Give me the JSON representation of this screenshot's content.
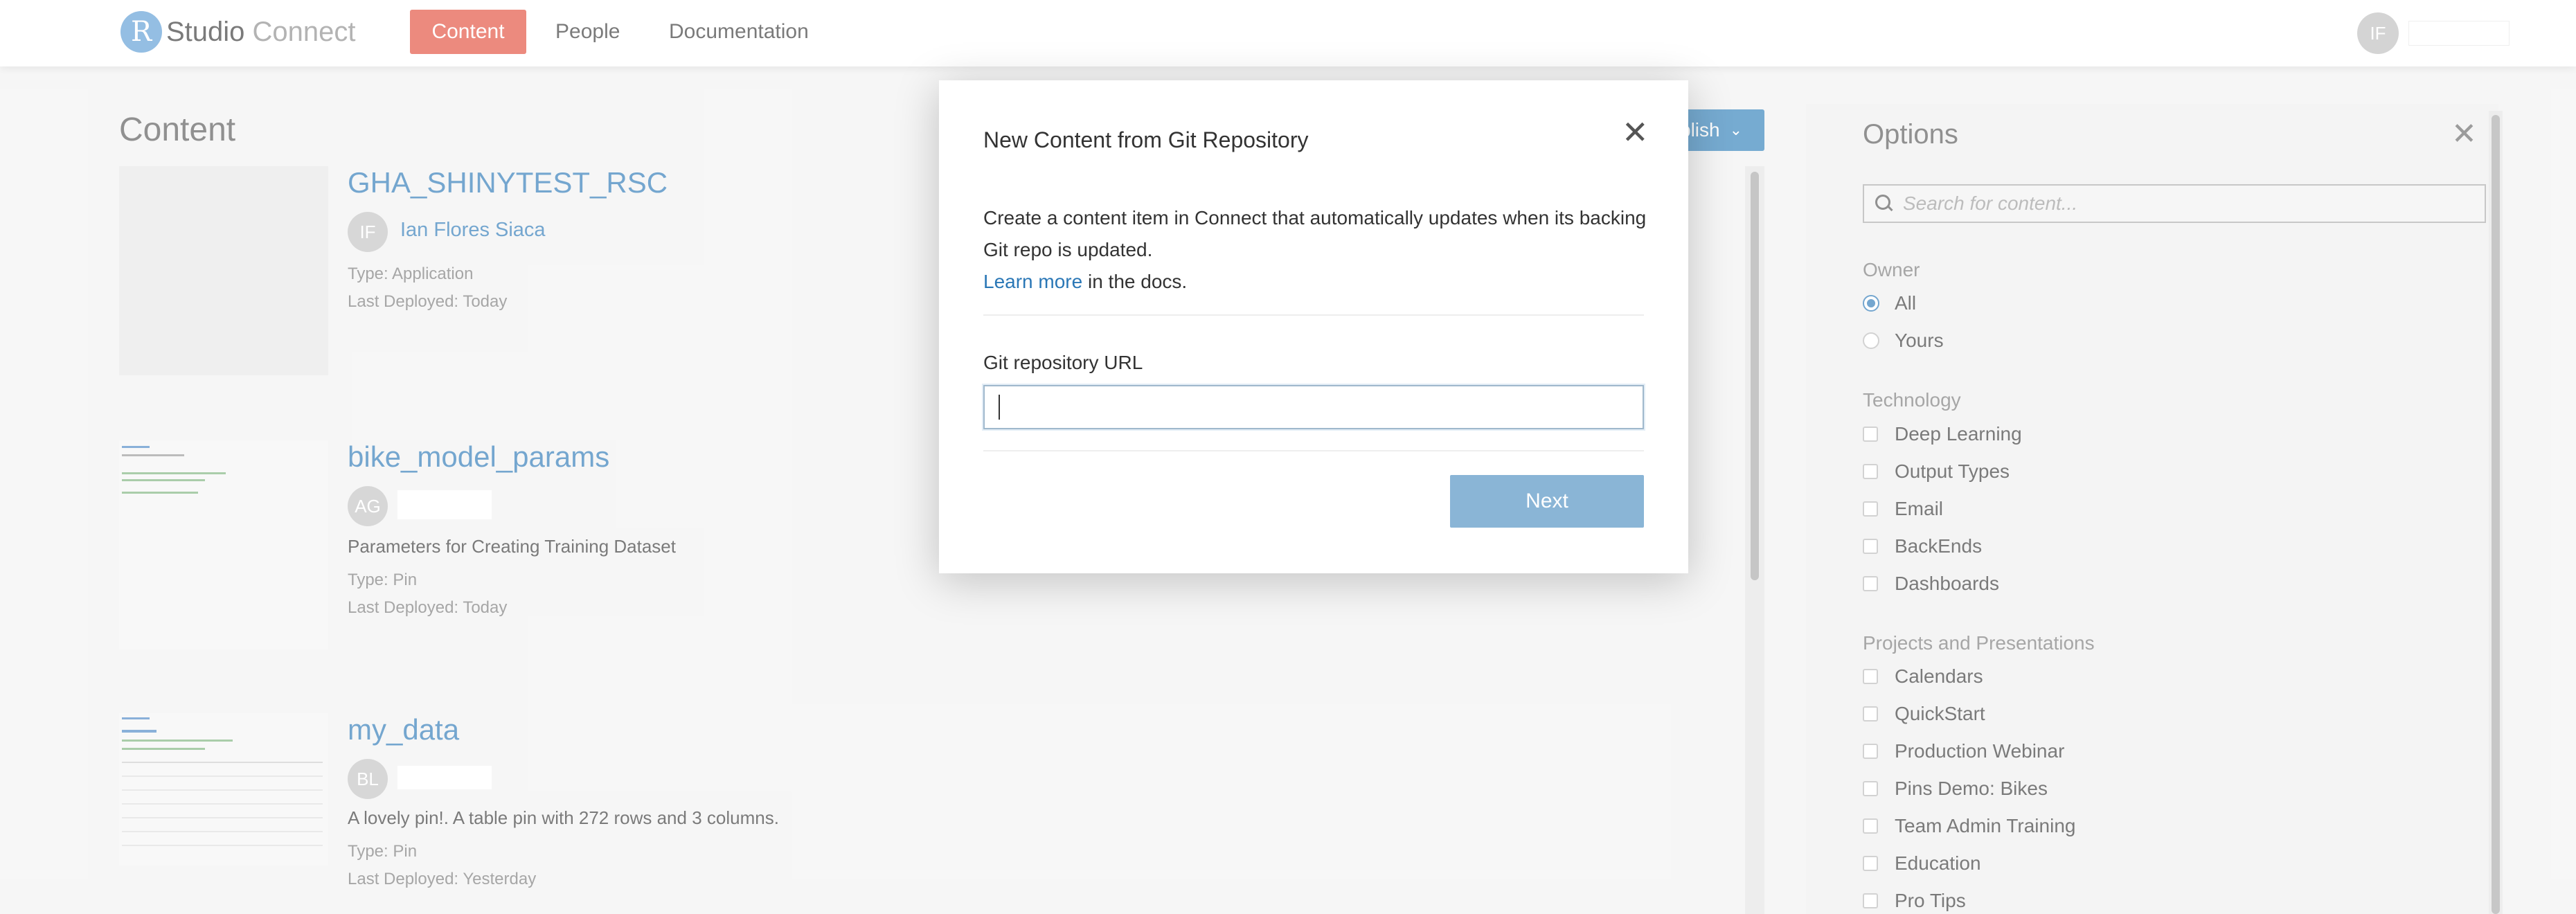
{
  "nav": {
    "logo_letter": "R",
    "logo_word1": "Studio",
    "logo_word2": "Connect",
    "items": [
      "Content",
      "People",
      "Documentation"
    ],
    "avatar_initials": "IF"
  },
  "content": {
    "title": "Content",
    "publish_label": "blish",
    "items": [
      {
        "title": "GHA_SHINYTEST_RSC",
        "owner_initials": "IF",
        "owner": "Ian Flores Siaca",
        "description": "",
        "type": "Type: Application",
        "deployed": "Last Deployed: Today"
      },
      {
        "title": "bike_model_params",
        "owner_initials": "AG",
        "owner": "",
        "description": "Parameters for Creating Training Dataset",
        "type": "Type: Pin",
        "deployed": "Last Deployed: Today"
      },
      {
        "title": "my_data",
        "owner_initials": "BL",
        "owner": "",
        "description": "A lovely pin!. A table pin with 272 rows and 3 columns.",
        "type": "Type: Pin",
        "deployed": "Last Deployed: Yesterday"
      }
    ]
  },
  "options": {
    "title": "Options",
    "search_placeholder": "Search for content...",
    "owner_label": "Owner",
    "owner_options": [
      {
        "label": "All",
        "selected": true
      },
      {
        "label": "Yours",
        "selected": false
      }
    ],
    "technology_label": "Technology",
    "technology": [
      "Deep Learning",
      "Output Types",
      "Email",
      "BackEnds",
      "Dashboards"
    ],
    "projects_label": "Projects and Presentations",
    "projects": [
      "Calendars",
      "QuickStart",
      "Production Webinar",
      "Pins Demo: Bikes",
      "Team Admin Training",
      "Education",
      "Pro Tips"
    ]
  },
  "modal": {
    "title": "New Content from Git Repository",
    "body_text": "Create a content item in Connect that automatically updates when its backing Git repo is updated.",
    "learn_more": "Learn more",
    "body_suffix": " in the docs.",
    "field_label": "Git repository URL",
    "url_value": "",
    "next_label": "Next"
  },
  "colors": {
    "accent": "#e24c3a",
    "link": "#2a77b6",
    "primary_button": "#2d7fb8",
    "disabled_button": "#8ab5d6"
  }
}
